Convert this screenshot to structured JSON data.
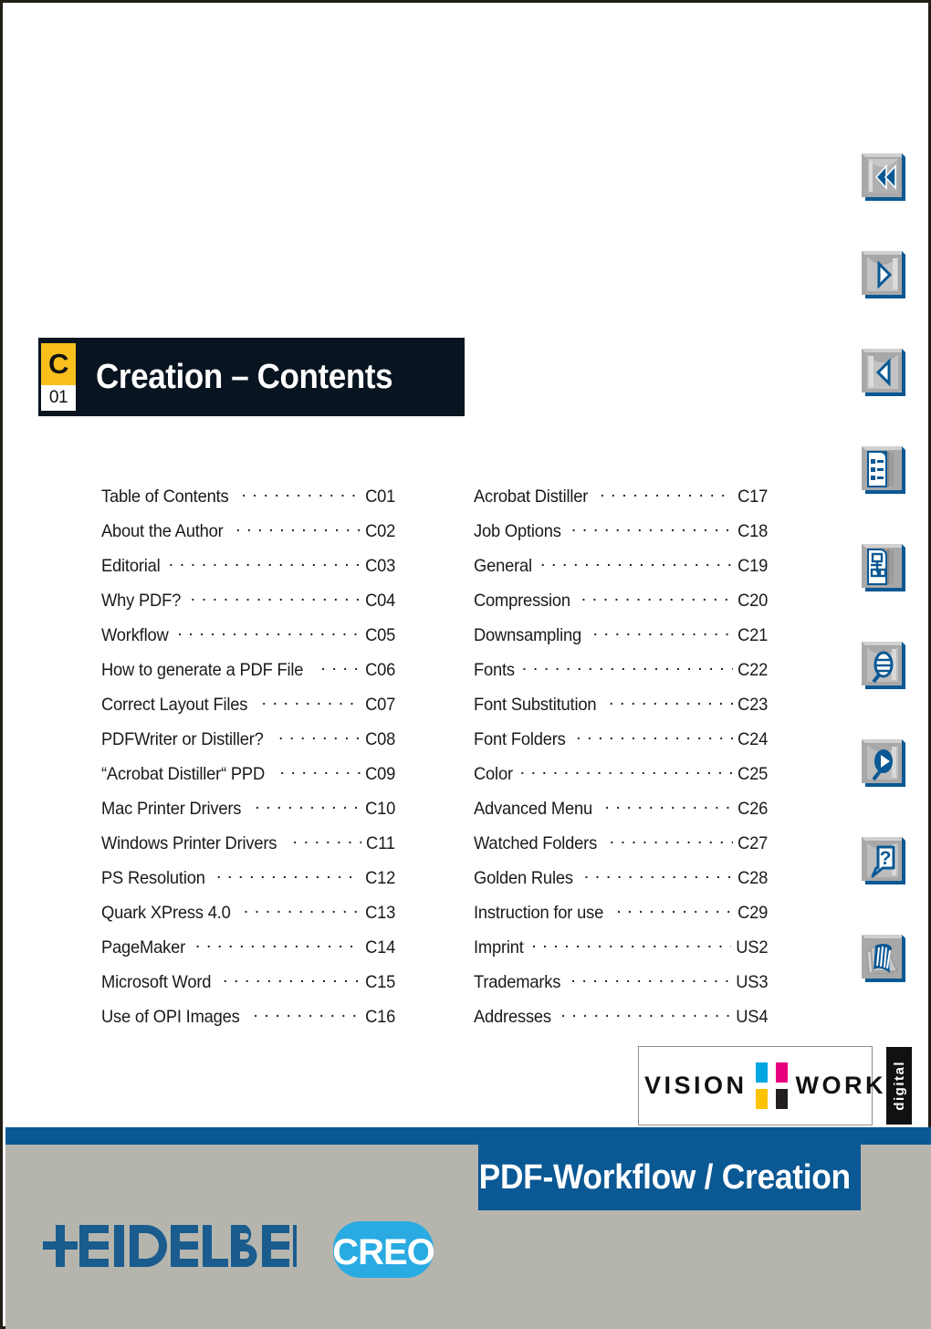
{
  "document": {
    "chapter_letter": "C",
    "chapter_number": "01",
    "title": "Creation – Contents",
    "footer_title": "PDF-Workflow / Creation"
  },
  "toc": {
    "left_column": [
      {
        "label": "Table of Contents",
        "page": "C01"
      },
      {
        "label": "About the Author",
        "page": "C02"
      },
      {
        "label": "Editorial",
        "page": "C03"
      },
      {
        "label": "Why PDF?",
        "page": "C04"
      },
      {
        "label": "Workflow",
        "page": "C05"
      },
      {
        "label": "How to generate a PDF File",
        "page": "C06"
      },
      {
        "label": "Correct Layout Files",
        "page": "C07"
      },
      {
        "label": "PDFWriter or Distiller?",
        "page": "C08"
      },
      {
        "label": "“Acrobat Distiller“ PPD",
        "page": "C09"
      },
      {
        "label": "Mac Printer Drivers",
        "page": "C10"
      },
      {
        "label": "Windows Printer Drivers",
        "page": "C11"
      },
      {
        "label": "PS Resolution",
        "page": "C12"
      },
      {
        "label": "Quark XPress 4.0",
        "page": "C13"
      },
      {
        "label": "PageMaker",
        "page": "C14"
      },
      {
        "label": "Microsoft Word",
        "page": "C15"
      },
      {
        "label": "Use of OPI Images",
        "page": "C16"
      }
    ],
    "right_column": [
      {
        "label": "Acrobat Distiller",
        "page": "C17"
      },
      {
        "label": "Job Options",
        "page": "C18"
      },
      {
        "label": "General",
        "page": "C19"
      },
      {
        "label": "Compression",
        "page": "C20"
      },
      {
        "label": "Downsampling",
        "page": "C21"
      },
      {
        "label": "Fonts",
        "page": "C22"
      },
      {
        "label": "Font Substitution",
        "page": "C23"
      },
      {
        "label": "Font Folders",
        "page": "C24"
      },
      {
        "label": "Color",
        "page": "C25"
      },
      {
        "label": "Advanced Menu",
        "page": "C26"
      },
      {
        "label": "Watched Folders",
        "page": "C27"
      },
      {
        "label": "Golden Rules",
        "page": "C28"
      },
      {
        "label": "Instruction for use",
        "page": "C29"
      },
      {
        "label": "Imprint",
        "page": "US2"
      },
      {
        "label": "Trademarks",
        "page": "US3"
      },
      {
        "label": "Addresses",
        "page": "US4"
      }
    ]
  },
  "nav_rail": {
    "buttons": [
      {
        "icon": "first-page-icon"
      },
      {
        "icon": "next-page-icon"
      },
      {
        "icon": "previous-page-icon"
      },
      {
        "icon": "table-of-contents-icon"
      },
      {
        "icon": "document-structure-icon"
      },
      {
        "icon": "search-icon"
      },
      {
        "icon": "search-again-icon"
      },
      {
        "icon": "help-icon"
      },
      {
        "icon": "pages-overview-icon"
      }
    ]
  },
  "logos": {
    "visionwork": {
      "word_left": "VISION",
      "word_right": "WORK",
      "suffix": "digital",
      "dot_colors": [
        "#00a6e2",
        "#e6007e",
        "#fdc300",
        "#231f20"
      ]
    },
    "heidelberg": "HEIDELBERG",
    "creo": "CREO"
  },
  "colors": {
    "banner_bg": "#081420",
    "chapter_tab": "#f9bf1d",
    "accent_blue": "#0a5894",
    "footer_gray": "#b5b5ae",
    "creo_cyan": "#29abe2",
    "heidelberg_blue": "#1a5c8e"
  }
}
